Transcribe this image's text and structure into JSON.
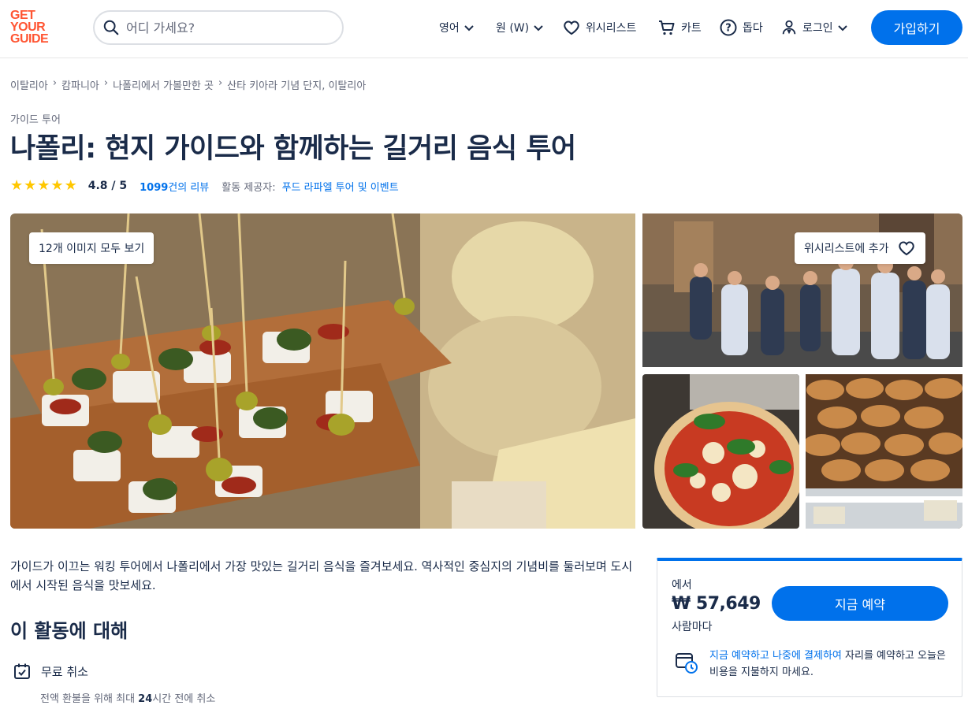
{
  "header": {
    "logo_lines": [
      "GET",
      "YOUR",
      "GUIDE"
    ],
    "search_placeholder": "어디 가세요?",
    "language": "영어",
    "currency": "원 (W)",
    "wishlist": "위시리스트",
    "cart": "카트",
    "help": "돕다",
    "login": "로그인",
    "signup": "가입하기"
  },
  "breadcrumb": [
    "이탈리아",
    "캄파니아",
    "나폴리에서 가볼만한 곳",
    "산타 키아라 기념 단지, 이탈리아"
  ],
  "activity": {
    "category": "가이드 투어",
    "title": "나폴리: 현지 가이드와 함께하는 길거리 음식 투어",
    "rating_text": "4.8 / 5",
    "rating_value": 4.8,
    "rating_max": 5,
    "reviews_count": "1099",
    "reviews_suffix": "건의 리뷰",
    "provider_label": "활동 제공자:",
    "provider_name": "푸드 라파엘 투어 및 이벤트"
  },
  "gallery": {
    "see_all": "12개 이미지 모두 보기",
    "wishlist_add": "위시리스트에 추가",
    "images": [
      "street-food-skewers",
      "tour-group-street",
      "pizza",
      "croissants"
    ]
  },
  "description": "가이드가 이끄는 워킹 투어에서 나폴리에서 가장 맛있는 길거리 음식을 즐겨보세요. 역사적인 중심지의 기념비를 둘러보며 도시에서 시작된 음식을 맛보세요.",
  "about": {
    "title": "이 활동에 대해",
    "free_cancel": "무료 취소",
    "free_cancel_sub_pre": "전액 환불을 위해 최대 ",
    "free_cancel_sub_bold": "24",
    "free_cancel_sub_post": "시간 전에 취소"
  },
  "booking": {
    "from": "에서",
    "price": "₩ 57,649",
    "per": "사람마다",
    "book_now": "지금 예약",
    "reserve_link": "지금 예약하고 나중에 결제하여",
    "reserve_text": " 자리를 예약하고 오늘은 비용을 지불하지 마세요."
  },
  "colors": {
    "accent": "#0071eb",
    "brand": "#ff5533",
    "star": "#ffc700",
    "text": "#1a2b49"
  }
}
